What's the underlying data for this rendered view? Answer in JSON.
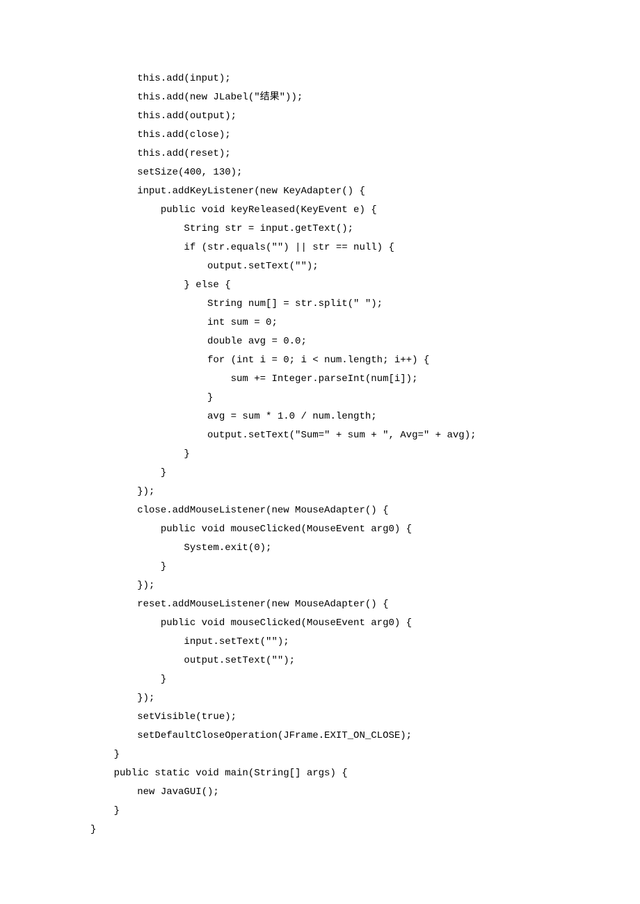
{
  "code": {
    "lines": [
      "        this.add(input);",
      "        this.add(new JLabel(\"结果\"));",
      "        this.add(output);",
      "        this.add(close);",
      "        this.add(reset);",
      "        setSize(400, 130);",
      "        input.addKeyListener(new KeyAdapter() {",
      "            public void keyReleased(KeyEvent e) {",
      "                String str = input.getText();",
      "                if (str.equals(\"\") || str == null) {",
      "                    output.setText(\"\");",
      "                } else {",
      "                    String num[] = str.split(\" \");",
      "                    int sum = 0;",
      "                    double avg = 0.0;",
      "                    for (int i = 0; i < num.length; i++) {",
      "                        sum += Integer.parseInt(num[i]);",
      "                    }",
      "                    avg = sum * 1.0 / num.length;",
      "                    output.setText(\"Sum=\" + sum + \", Avg=\" + avg);",
      "                }",
      "            }",
      "        });",
      "        close.addMouseListener(new MouseAdapter() {",
      "            public void mouseClicked(MouseEvent arg0) {",
      "                System.exit(0);",
      "            }",
      "        });",
      "        reset.addMouseListener(new MouseAdapter() {",
      "            public void mouseClicked(MouseEvent arg0) {",
      "                input.setText(\"\");",
      "                output.setText(\"\");",
      "            }",
      "        });",
      "        setVisible(true);",
      "        setDefaultCloseOperation(JFrame.EXIT_ON_CLOSE);",
      "    }",
      "    public static void main(String[] args) {",
      "        new JavaGUI();",
      "    }",
      "}"
    ]
  }
}
